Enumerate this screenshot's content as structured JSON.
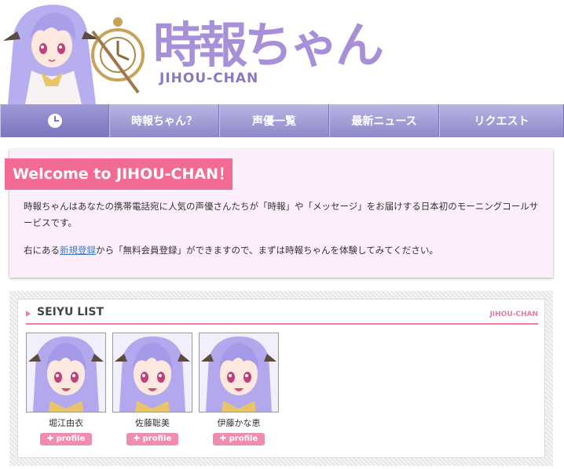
{
  "header": {
    "logo_ja": "時報ちゃん",
    "logo_en": "JIHOU-CHAN"
  },
  "nav": {
    "home_icon": "clock-icon",
    "items": [
      {
        "label": "時報ちゃん？"
      },
      {
        "label": "声優一覧"
      },
      {
        "label": "最新ニュース"
      },
      {
        "label": "リクエスト"
      }
    ]
  },
  "welcome": {
    "banner": "Welcome to JIHOU-CHAN！",
    "paragraph1": "時報ちゃんはあなたの携帯電話宛に人気の声優さんたちが「時報」や「メッセージ」をお届けする日本初のモーニングコールサービスです。",
    "paragraph2_before": "右にある",
    "paragraph2_link": "新規登録",
    "paragraph2_after": "から「無料会員登録」ができますので、まずは時報ちゃんを体験してみてください。"
  },
  "seiyu": {
    "title": "SEIYU LIST",
    "brand": "JIHOU-CHAN",
    "cards": [
      {
        "name": "堀江由衣",
        "button": "profile"
      },
      {
        "name": "佐藤聡美",
        "button": "profile"
      },
      {
        "name": "伊藤かな恵",
        "button": "profile"
      }
    ]
  },
  "colors": {
    "nav": "#8d88c8",
    "accent_pink": "#f26b94",
    "welcome_bg": "#fdeefb",
    "logo_purple": "#a890d8"
  }
}
